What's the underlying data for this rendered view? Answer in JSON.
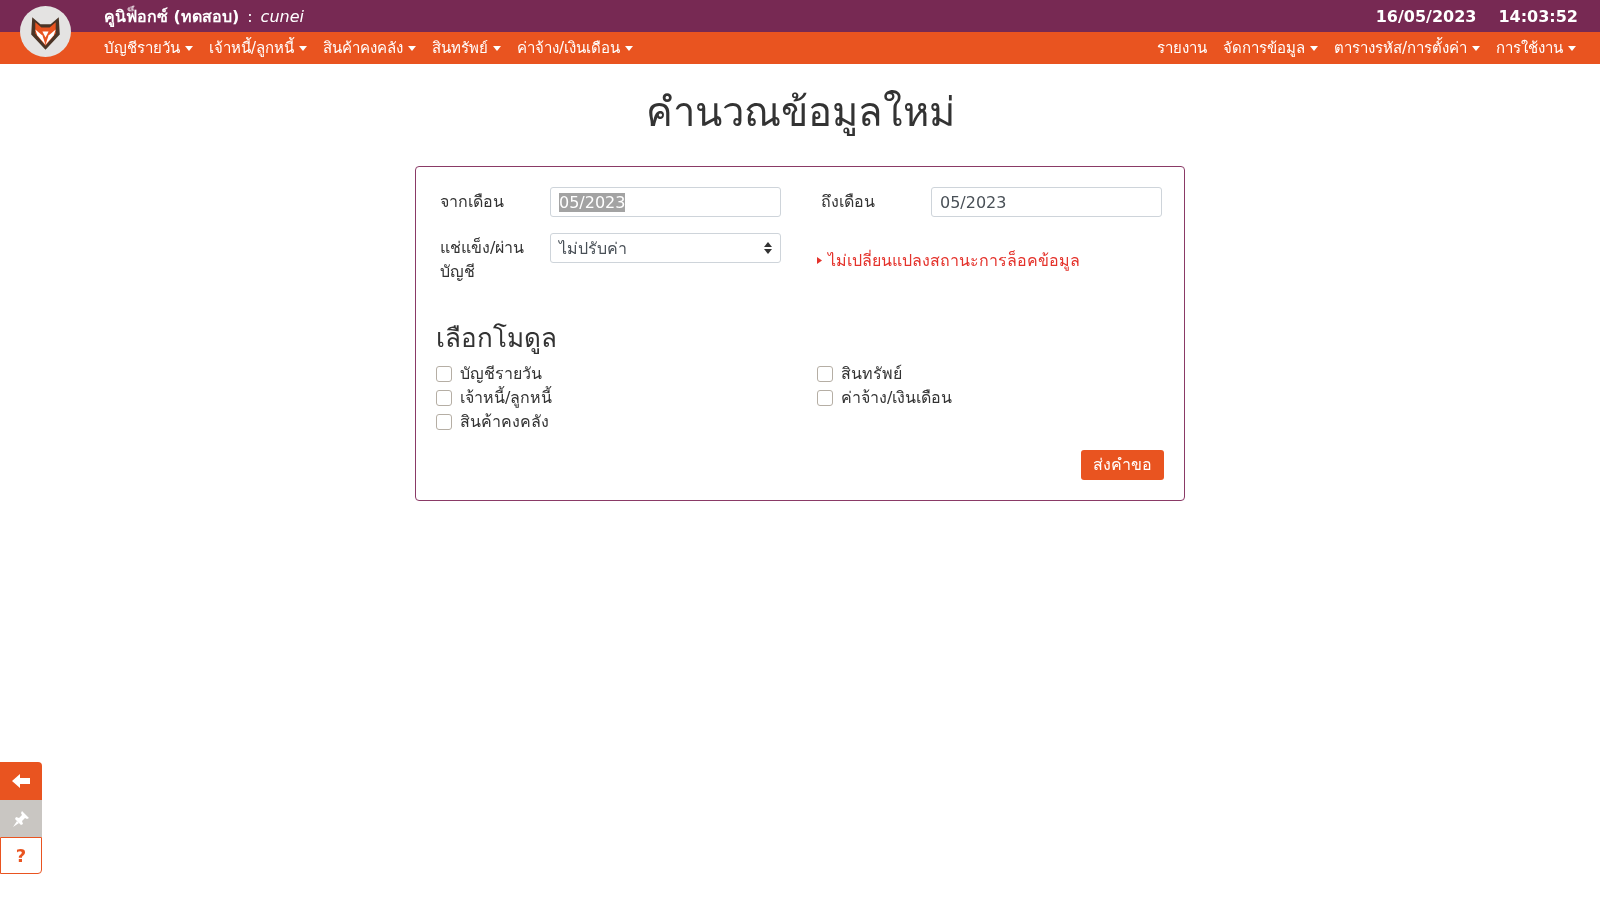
{
  "header": {
    "app_title": "คูนิฟ็อกซ์ (ทดสอบ)",
    "separator": ":",
    "user": "cunei",
    "date": "16/05/2023",
    "time": "14:03:52"
  },
  "nav_left": [
    {
      "label": "บัญชีรายวัน",
      "dropdown": true
    },
    {
      "label": "เจ้าหนี้/ลูกหนี้",
      "dropdown": true
    },
    {
      "label": "สินค้าคงคลัง",
      "dropdown": true
    },
    {
      "label": "สินทรัพย์",
      "dropdown": true
    },
    {
      "label": "ค่าจ้าง/เงินเดือน",
      "dropdown": true
    }
  ],
  "nav_right": [
    {
      "label": "รายงาน",
      "dropdown": false
    },
    {
      "label": "จัดการข้อมูล",
      "dropdown": true
    },
    {
      "label": "ตารางรหัส/การตั้งค่า",
      "dropdown": true
    },
    {
      "label": "การใช้งาน",
      "dropdown": true
    }
  ],
  "page_title": "คำนวณข้อมูลใหม่",
  "form": {
    "from_month": {
      "label": "จากเดือน",
      "value": "05/2023",
      "text_selected": true
    },
    "to_month": {
      "label": "ถึงเดือน",
      "value": "05/2023",
      "text_selected": false
    },
    "freeze": {
      "label": "แช่แข็ง/ผ่านบัญชี",
      "value": "ไม่ปรับค่า"
    },
    "note": "ไม่เปลี่ยนแปลงสถานะการล็อคข้อมูล"
  },
  "modules_title": "เลือกโมดูล",
  "modules": [
    {
      "label": "บัญชีรายวัน",
      "checked": false
    },
    {
      "label": "เจ้าหนี้/ลูกหนี้",
      "checked": false
    },
    {
      "label": "สินค้าคงคลัง",
      "checked": false
    },
    {
      "label": "สินทรัพย์",
      "checked": false
    },
    {
      "label": "ค่าจ้าง/เงินเดือน",
      "checked": false
    }
  ],
  "submit_button": "ส่งคำขอ",
  "side_toolbar": [
    {
      "kind": "back"
    },
    {
      "kind": "pin"
    },
    {
      "kind": "help",
      "label": "?"
    }
  ]
}
